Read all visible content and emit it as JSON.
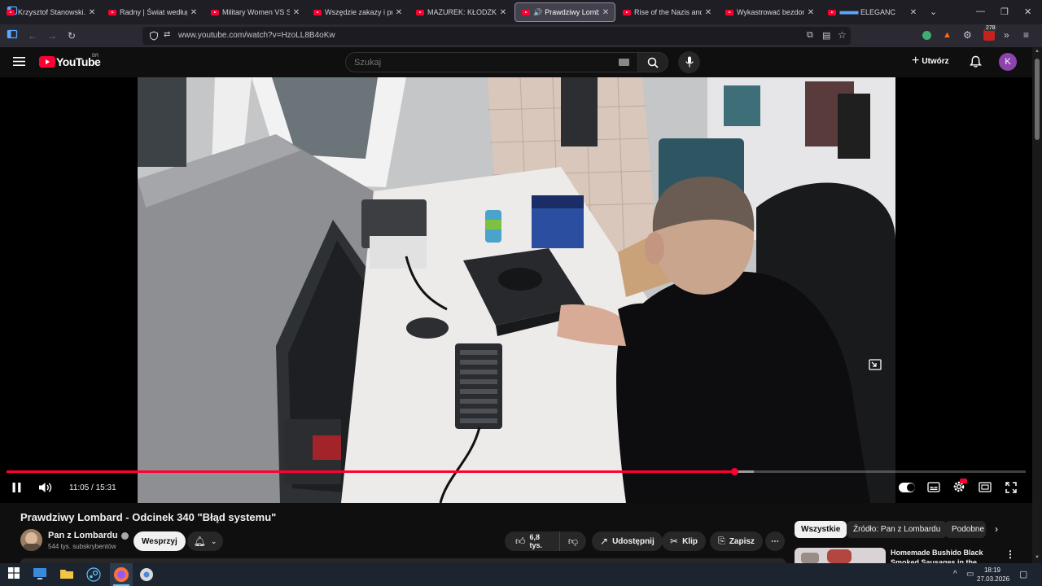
{
  "browser": {
    "tabs": [
      {
        "title": "Krzysztof Stanowski. W ja"
      },
      {
        "title": "Radny | Świat według Kie"
      },
      {
        "title": "Military Women VS Skinn"
      },
      {
        "title": "Wszędzie zakazy i preten"
      },
      {
        "title": "MAZUREK: KŁODZKO, PL"
      },
      {
        "title": "Prawdziwy Lombard",
        "active": true
      },
      {
        "title": "Rise of the Nazis and Adi"
      },
      {
        "title": "Wykastrować bezdomno"
      },
      {
        "title": "ELEGANC"
      }
    ],
    "url": "www.youtube.com/watch?v=HzoLL8B4oKw",
    "extension_badge": "278"
  },
  "youtube": {
    "logo_text": "YouTube",
    "region": "BR",
    "search_placeholder": "Szukaj",
    "create_label": "Utwórz",
    "avatar_letter": "K"
  },
  "player": {
    "current_time": "11:05",
    "duration": "15:31",
    "time_display": "11:05 / 15:31",
    "played_fraction": 0.7143,
    "buffered_fraction": 0.733
  },
  "video": {
    "title": "Prawdziwy Lombard - Odcinek 340 \"Błąd systemu\"",
    "channel": "Pan z Lombardu",
    "subscribers": "544 tys. subskrybentów",
    "support_label": "Wesprzyj",
    "likes": "6,8 tys.",
    "share_label": "Udostępnij",
    "clip_label": "Klip",
    "save_label": "Zapisz"
  },
  "sidebar": {
    "chips": [
      "Wszystkie",
      "Źródło: Pan z Lombardu",
      "Podobne"
    ],
    "first_video_title_line1": "Homemade Bushido Black",
    "first_video_title_line2": "Smoked Sausages in the"
  },
  "taskbar": {
    "time": "18:19",
    "date": "27.03.2026"
  },
  "colors": {
    "accent": "#ff0033",
    "background": "#0f0f0f",
    "avatar": "#8e44ad"
  }
}
